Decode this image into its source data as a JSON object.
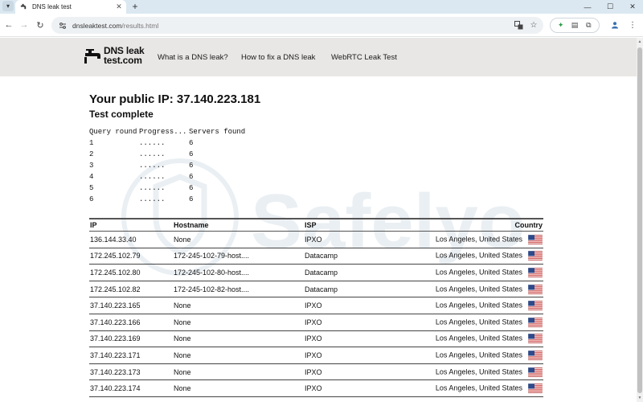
{
  "browser": {
    "tab_title": "DNS leak test",
    "url_host": "dnsleaktest.com",
    "url_path": "/results.html",
    "accent": "#dbe8f1"
  },
  "site": {
    "logo_line1": "DNS leak",
    "logo_line2": "test.com",
    "nav": [
      "What is a DNS leak?",
      "How to fix a DNS leak",
      "WebRTC Leak Test"
    ]
  },
  "watermark_text": "Safelyo",
  "heading": "Your public IP: 37.140.223.181",
  "status": "Test complete",
  "query_rounds": {
    "headers": [
      "Query round",
      "Progress...",
      "Servers found"
    ],
    "rows": [
      [
        "1",
        "......",
        "6"
      ],
      [
        "2",
        "......",
        "6"
      ],
      [
        "3",
        "......",
        "6"
      ],
      [
        "4",
        "......",
        "6"
      ],
      [
        "5",
        "......",
        "6"
      ],
      [
        "6",
        "......",
        "6"
      ]
    ]
  },
  "results": {
    "headers": [
      "IP",
      "Hostname",
      "ISP",
      "Country"
    ],
    "rows": [
      [
        "136.144.33.40",
        "None",
        "IPXO",
        "Los Angeles, United States"
      ],
      [
        "172.245.102.79",
        "172-245-102-79-host....",
        "Datacamp",
        "Los Angeles, United States"
      ],
      [
        "172.245.102.80",
        "172-245-102-80-host....",
        "Datacamp",
        "Los Angeles, United States"
      ],
      [
        "172.245.102.82",
        "172-245-102-82-host....",
        "Datacamp",
        "Los Angeles, United States"
      ],
      [
        "37.140.223.165",
        "None",
        "IPXO",
        "Los Angeles, United States"
      ],
      [
        "37.140.223.166",
        "None",
        "IPXO",
        "Los Angeles, United States"
      ],
      [
        "37.140.223.169",
        "None",
        "IPXO",
        "Los Angeles, United States"
      ],
      [
        "37.140.223.171",
        "None",
        "IPXO",
        "Los Angeles, United States"
      ],
      [
        "37.140.223.173",
        "None",
        "IPXO",
        "Los Angeles, United States"
      ],
      [
        "37.140.223.174",
        "None",
        "IPXO",
        "Los Angeles, United States"
      ]
    ]
  }
}
